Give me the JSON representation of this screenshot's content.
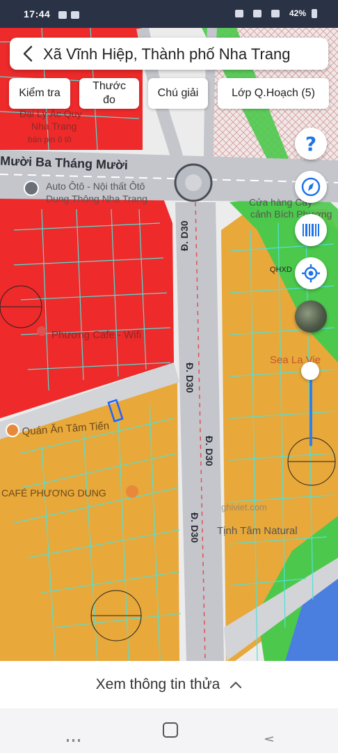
{
  "status_bar": {
    "time": "17:44",
    "battery": "42%"
  },
  "header": {
    "back_icon": "chevron-left-icon",
    "title": "Xã Vĩnh Hiệp, Thành phố Nha Trang"
  },
  "toolbar": {
    "measure_check": "Kiểm tra",
    "ruler_line1": "Thước",
    "ruler_line2": "đo",
    "legend": "Chú giải",
    "planning_layers": "Lớp Q.Hoạch (5)"
  },
  "side_controls": {
    "help_glyph": "?",
    "compass_icon": "compass-icon",
    "barcode_icon": "barcode-icon",
    "locate_icon": "gps-locate-icon",
    "satellite_icon": "satellite-layer-thumbnail",
    "opacity_slider_level": 1.0
  },
  "map": {
    "road_main": "Mười Ba Tháng Mười",
    "road_d30_a": "Đ. D30",
    "road_d30_b": "Đ. D30",
    "road_d30_c": "Đ. D30",
    "road_d30_d": "Đ. D30",
    "poi_battery_shop": "Đại Lý Ắc Quy",
    "poi_battery_shop_sub": "Nha Trang",
    "poi_battery_shop_note": "bán pin ô tô",
    "poi_auto": "Auto Ôtô - Nội thất Ôtô",
    "poi_auto_sub": "Dung Thông Nha Trang",
    "poi_shop_right": "Cửa hàng Cây",
    "poi_shop_right_sub": "cảnh Bích Phượng",
    "poi_cafe": "Phương Cafe - Wifi",
    "poi_restaurant": "Quán Ăn Tâm Tiến",
    "poi_cafe_phuong_dung": "CAFÉ PHƯƠNG DUNG",
    "poi_sea": "Sea La Vie",
    "poi_natural": "Tịnh Tâm Natural",
    "zone_code_label": "QHXD",
    "watermark": "ghiviet.com",
    "colors": {
      "residential_red": "#ee2a2a",
      "planned_orange": "#e8a83a",
      "green_park": "#4cc94c",
      "road_grey": "#c4c6cc",
      "parcel_lines": "#52e0d9",
      "water_blue": "#4a7fe0"
    }
  },
  "bottom_panel": {
    "label": "Xem thông tin thửa",
    "chevron_icon": "chevron-up-icon"
  },
  "nav_bar": {
    "recent_icon": "recent-apps-icon",
    "home_icon": "home-icon",
    "back_icon": "nav-back-icon"
  }
}
